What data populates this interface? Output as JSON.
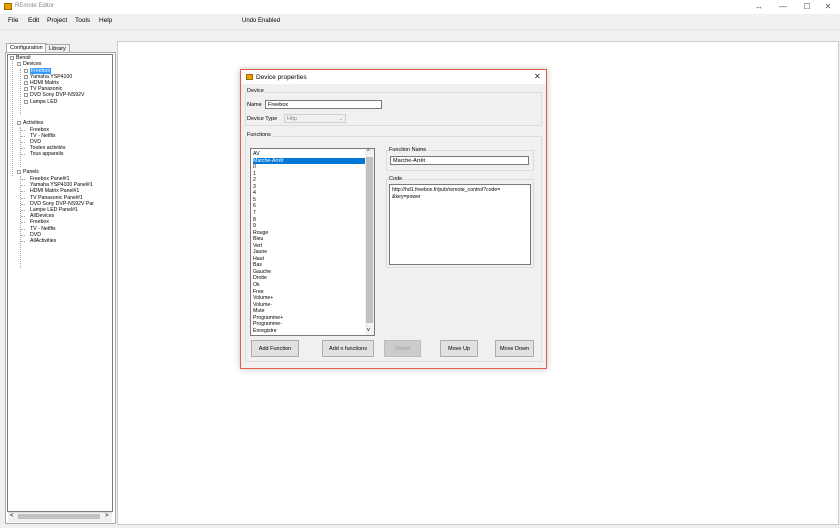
{
  "app": {
    "title": "REmote Editor",
    "undo_status": "Undo Enabled",
    "window_controls": {
      "resize": "↔",
      "minimize": "—",
      "maximize": "☐",
      "close": "✕"
    }
  },
  "menu": [
    "File",
    "Edit",
    "Project",
    "Tools",
    "Help"
  ],
  "left_panel": {
    "tabs": [
      "Configuration",
      "Library"
    ],
    "tree": {
      "root": "Benoit",
      "devices_label": "Devices",
      "devices": [
        "Freebox",
        "Yamaha YSP4100",
        "HDMI Matrix",
        "TV Panasonic",
        "DVD Sony DVP-NS92V",
        "Lampe LED"
      ],
      "activities_label": "Activities",
      "activities": [
        "Freebox",
        "TV - Netflix",
        "DVD",
        "Toutes activités",
        "Tous appareils"
      ],
      "panels_label": "Panels",
      "panels": [
        "Freebox Panel#1",
        "Yamaha YSP4100 Panel#1",
        "HDMI Matrix Panel#1",
        "TV Panasonic Panel#1",
        "DVD Sony DVP-NS92V Par",
        "Lampe LED Panel#1",
        "AllDevices",
        "Freebox",
        "TV - Netflix",
        "DVD",
        "AllActivities"
      ]
    },
    "scroll_left": "<",
    "scroll_right": ">"
  },
  "dialog": {
    "title": "Device properties",
    "close": "✕",
    "device_group": "Device",
    "name_label": "Name",
    "name_value": "Freebox",
    "type_label": "Device Type",
    "type_value": "Http",
    "functions_group": "Functions",
    "functions": [
      "AV",
      "Marche-Arrêt",
      "0",
      "1",
      "2",
      "3",
      "4",
      "5",
      "6",
      "7",
      "8",
      "9",
      "Rouge",
      "Bleu",
      "Vert",
      "Jaune",
      "Haut",
      "Bas",
      "Gauche",
      "Droite",
      "Ok",
      "Free",
      "Volume+",
      "Volume-",
      "Mute",
      "Programme+",
      "Programme-",
      "Enregistre"
    ],
    "selected_function_index": 1,
    "function_name_label": "Function Name",
    "function_name_value": "Marche-Arrêt",
    "code_label": "Code",
    "code_value": "http://hd1.freebox.fr/pub/remote_control?code=             &key=power",
    "buttons": {
      "add_function": "Add Function",
      "add_n_functions": "Add n functions",
      "delete": "Delete",
      "move_up": "Move Up",
      "move_down": "Move Down"
    },
    "scroll_up": "^",
    "scroll_down": "v"
  }
}
